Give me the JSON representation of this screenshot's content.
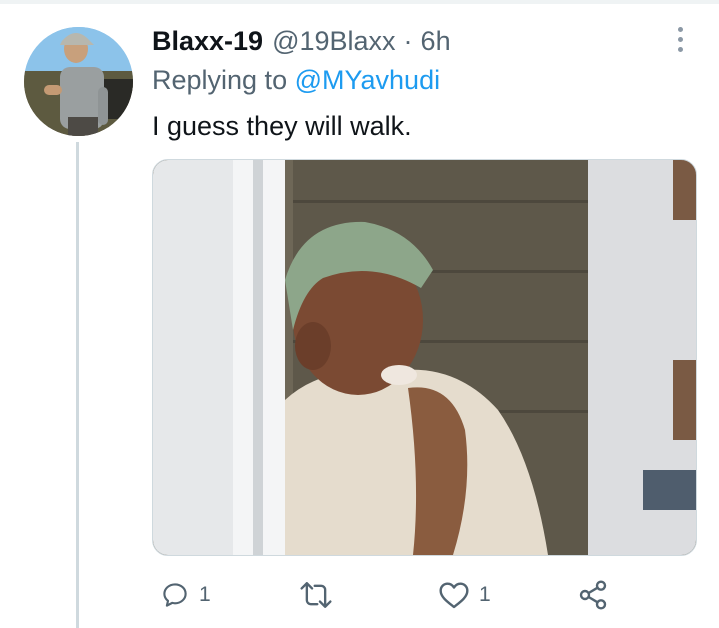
{
  "tweet": {
    "display_name": "Blaxx-19",
    "handle": "@19Blaxx",
    "separator": "·",
    "time": "6h",
    "reply_prefix": "Replying to",
    "reply_to": "@MYavhudi",
    "text": "I guess they will walk."
  },
  "icons": {
    "more": "more-vertical-icon",
    "reply": "comment-icon",
    "retweet": "retweet-icon",
    "like": "heart-icon",
    "share": "share-icon"
  },
  "actions": {
    "reply_count": "1",
    "retweet_count": "",
    "like_count": "1"
  },
  "colors": {
    "accent": "#1d9bf0",
    "secondary_text": "#536471",
    "primary_text": "#0f1419",
    "thread_line": "#cfd9de"
  }
}
